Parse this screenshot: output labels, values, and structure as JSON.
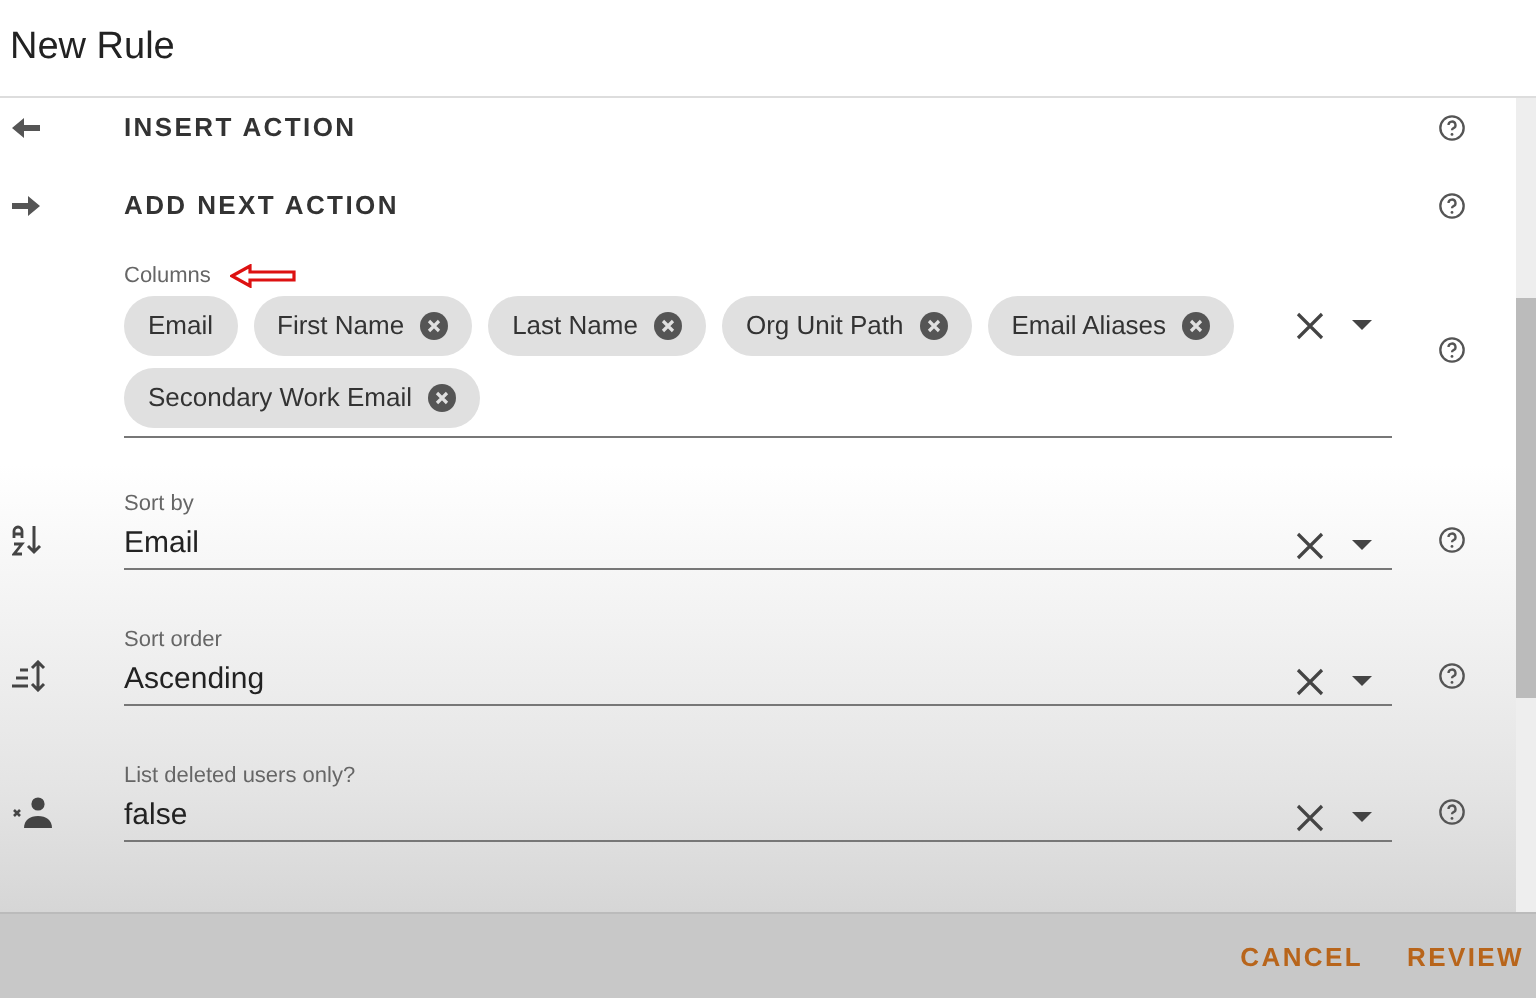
{
  "window": {
    "title": "New Rule"
  },
  "actions": [
    {
      "label": "INSERT ACTION",
      "kind": "insert"
    },
    {
      "label": "ADD NEXT ACTION",
      "kind": "next"
    }
  ],
  "columns": {
    "label": "Columns",
    "annotated": true,
    "chips": [
      {
        "label": "Email",
        "deletable": false
      },
      {
        "label": "First Name",
        "deletable": true
      },
      {
        "label": "Last Name",
        "deletable": true
      },
      {
        "label": "Org Unit Path",
        "deletable": true
      },
      {
        "label": "Email Aliases",
        "deletable": true
      },
      {
        "label": "Secondary Work Email",
        "deletable": true
      }
    ]
  },
  "fields": [
    {
      "label": "Sort by",
      "value": "Email",
      "kind": "sort"
    },
    {
      "label": "Sort order",
      "value": "Ascending",
      "kind": "order"
    },
    {
      "label": "List deleted users only?",
      "value": "false",
      "kind": "deleted"
    }
  ],
  "buttons": [
    "CANCEL",
    "REVIEW"
  ]
}
